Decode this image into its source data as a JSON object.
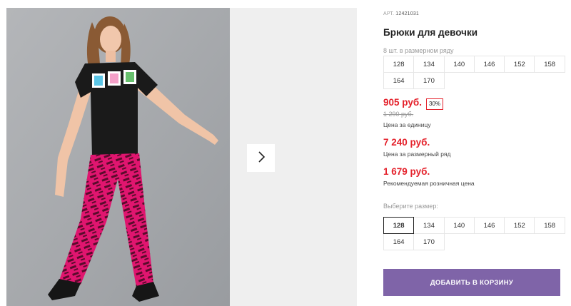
{
  "product": {
    "article_label": "АРТ.",
    "article_value": "12421031",
    "title": "Брюки для девочки"
  },
  "size_range": {
    "label": "8 шт. в размерном ряду",
    "sizes": [
      "128",
      "134",
      "140",
      "146",
      "152",
      "158",
      "164",
      "170"
    ]
  },
  "pricing": {
    "unit_price": "905 руб.",
    "discount": "30%",
    "old_price": "1 290 руб.",
    "unit_label": "Цена за единицу",
    "range_price": "7 240 руб.",
    "range_label": "Цена за размерный ряд",
    "retail_price": "1 679 руб.",
    "retail_label": "Рекомендуемая розничная цена"
  },
  "size_picker": {
    "label": "Выберите размер:",
    "sizes": [
      "128",
      "134",
      "140",
      "146",
      "152",
      "158",
      "164",
      "170"
    ],
    "selected": "128"
  },
  "cart": {
    "add_label": "ДОБАВИТЬ В КОРЗИНУ"
  },
  "gallery": {
    "next_icon": "chevron-right-icon"
  },
  "colors": {
    "price_red": "#e4212b",
    "button_purple": "#7f64a8",
    "pants_pink": "#e0156f",
    "shirt_black": "#1a1a1a"
  }
}
